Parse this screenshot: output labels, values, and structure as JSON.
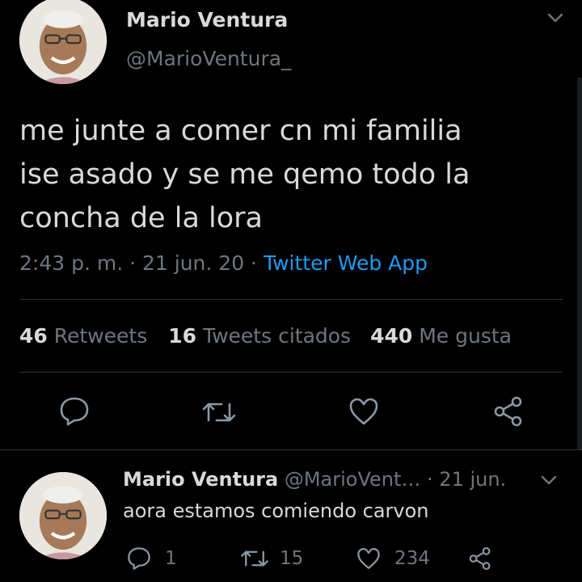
{
  "main_tweet": {
    "author_name": "Mario Ventura",
    "handle": "@MarioVentura_",
    "text_lines": [
      "me junte a comer cn mi familia",
      "ise asado y se me qemo todo la",
      "concha de la lora"
    ],
    "time": "2:43 p. m.",
    "separator1": " · ",
    "date": "21 jun. 20",
    "separator2": " · ",
    "client": "Twitter Web App",
    "stats": {
      "retweets_count": "46",
      "retweets_label": "Retweets",
      "quotes_count": "16",
      "quotes_label": "Tweets citados",
      "likes_count": "440",
      "likes_label": "Me gusta"
    },
    "actions": [
      "reply-icon",
      "retweet-icon",
      "like-icon",
      "share-icon"
    ]
  },
  "reply_tweet": {
    "author_name": "Mario Ventura",
    "handle": "@MarioVent…",
    "meta": " · 21 jun.",
    "text": "aora estamos comiendo carvon",
    "reply_count": "1",
    "retweet_count": "15",
    "like_count": "234"
  },
  "colors": {
    "background": "#000000",
    "text": "#d9d9d9",
    "muted": "#6e767d",
    "link": "#1d9bf0",
    "divider": "#2f3336"
  }
}
